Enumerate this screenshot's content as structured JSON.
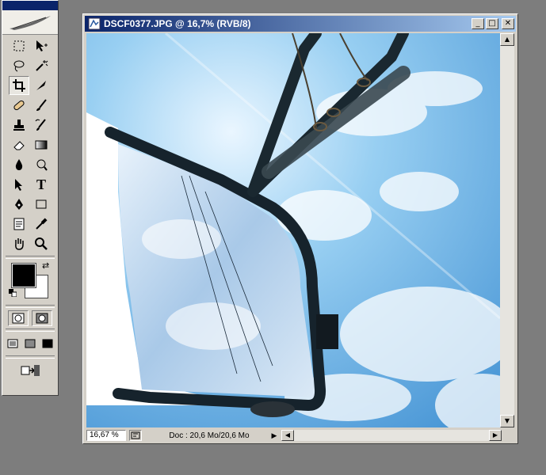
{
  "document": {
    "title": "DSCF0377.JPG @ 16,7% (RVB/8)",
    "zoom": "16,67 %",
    "doc_info": "Doc : 20,6 Mo/20,6 Mo"
  },
  "window_buttons": {
    "minimize": "_",
    "maximize": "□",
    "close": "✕"
  },
  "toolbox": {
    "tools": [
      {
        "name": "marquee",
        "icon": "marquee-icon"
      },
      {
        "name": "move",
        "icon": "move-icon"
      },
      {
        "name": "lasso",
        "icon": "lasso-icon"
      },
      {
        "name": "magic-wand",
        "icon": "magic-wand-icon"
      },
      {
        "name": "crop",
        "icon": "crop-icon",
        "active": true
      },
      {
        "name": "slice",
        "icon": "slice-icon"
      },
      {
        "name": "healing",
        "icon": "bandage-icon"
      },
      {
        "name": "brush",
        "icon": "brush-icon"
      },
      {
        "name": "clone-stamp",
        "icon": "stamp-icon"
      },
      {
        "name": "history-brush",
        "icon": "history-brush-icon"
      },
      {
        "name": "eraser",
        "icon": "eraser-icon"
      },
      {
        "name": "gradient",
        "icon": "gradient-icon"
      },
      {
        "name": "blur",
        "icon": "drop-icon"
      },
      {
        "name": "dodge",
        "icon": "dodge-icon"
      },
      {
        "name": "path-select",
        "icon": "arrow-icon"
      },
      {
        "name": "type",
        "icon": "type-icon"
      },
      {
        "name": "pen",
        "icon": "pen-icon"
      },
      {
        "name": "shape",
        "icon": "rectangle-icon"
      },
      {
        "name": "notes",
        "icon": "notes-icon"
      },
      {
        "name": "eyedropper",
        "icon": "eyedropper-icon"
      },
      {
        "name": "hand",
        "icon": "hand-icon"
      },
      {
        "name": "zoom",
        "icon": "magnifier-icon"
      }
    ],
    "type_glyph": "T",
    "colors": {
      "foreground": "#000000",
      "background": "#ffffff"
    }
  },
  "colors": {
    "titlebar_start": "#0a246a",
    "titlebar_end": "#a6caf0",
    "chrome": "#d4d0c8",
    "desktop": "#7d7d7d"
  }
}
